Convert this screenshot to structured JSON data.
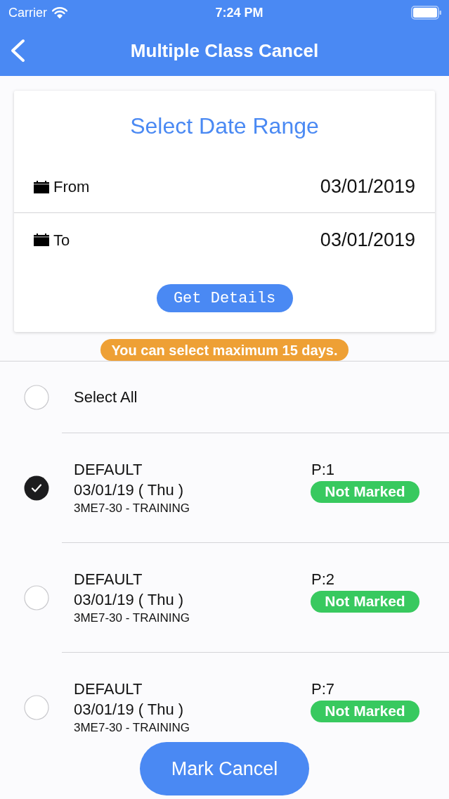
{
  "status_bar": {
    "carrier": "Carrier",
    "time": "7:24 PM"
  },
  "nav_bar": {
    "title": "Multiple Class Cancel"
  },
  "date_range": {
    "title": "Select Date Range",
    "fields": [
      {
        "label": "From",
        "value": "03/01/2019"
      },
      {
        "label": "To",
        "value": "03/01/2019"
      }
    ],
    "button": "Get Details"
  },
  "notice": "You can select maximum 15 days.",
  "select_all": {
    "label": "Select All",
    "checked": false
  },
  "classes": [
    {
      "name": "DEFAULT",
      "date": "03/01/19 ( Thu )",
      "subject": "3ME7-30 - TRAINING",
      "period": "P:1",
      "status": "Not Marked",
      "checked": true
    },
    {
      "name": "DEFAULT",
      "date": "03/01/19 ( Thu )",
      "subject": "3ME7-30 - TRAINING",
      "period": "P:2",
      "status": "Not Marked",
      "checked": false
    },
    {
      "name": "DEFAULT",
      "date": "03/01/19 ( Thu )",
      "subject": "3ME7-30 - TRAINING",
      "period": "P:7",
      "status": "Not Marked",
      "checked": false
    }
  ],
  "action_button": "Mark Cancel"
}
